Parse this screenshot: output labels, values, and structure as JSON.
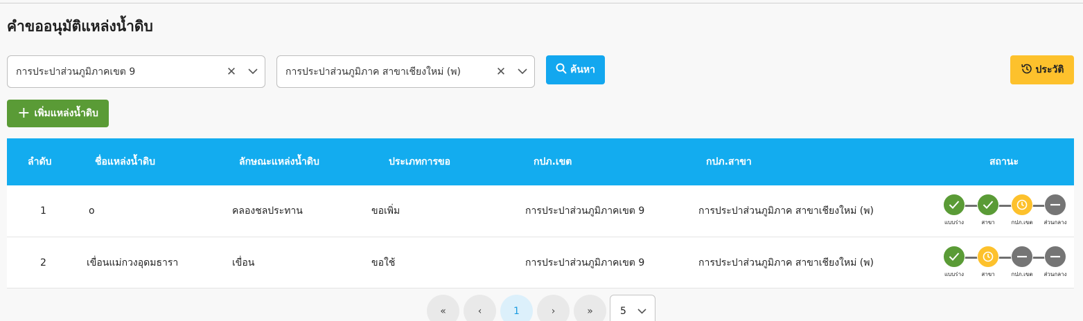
{
  "page": {
    "title": "คำขออนุมัติแหล่งน้ำดิบ"
  },
  "filters": {
    "region_value": "การประปาส่วนภูมิภาคเขต 9",
    "branch_value": "การประปาส่วนภูมิภาค สาขาเชียงใหม่ (พ)",
    "clear_icon": "close-icon",
    "dropdown_icon": "chevron-down-icon"
  },
  "buttons": {
    "search": "ค้นหา",
    "history": "ประวัติ",
    "add": "เพิ่มแหล่งน้ำดิบ"
  },
  "colors": {
    "header_bg": "#13acef",
    "search_bg": "#13a7ef",
    "history_bg": "#fdc12c",
    "add_bg": "#5a9b36",
    "status_done": "#5a9b36",
    "status_pending": "#fdc12c",
    "status_waiting": "#757575"
  },
  "table": {
    "headers": [
      "ลำดับ",
      "ชื่อแหล่งน้ำดิบ",
      "ลักษณะแหล่งน้ำดิบ",
      "ประเภทการขอ",
      "กปภ.เขต",
      "กปภ.สาขา",
      "สถานะ"
    ],
    "rows": [
      {
        "no": "1",
        "name": "o",
        "characteristic": "คลองชลประทาน",
        "request_type": "ขอเพิ่ม",
        "region": "การประปาส่วนภูมิภาคเขต 9",
        "branch": "การประปาส่วนภูมิภาค สาขาเชียงใหม่ (พ)",
        "status": [
          {
            "label": "แบบร่าง",
            "state": "done"
          },
          {
            "label": "สาขา",
            "state": "done"
          },
          {
            "label": "กปภ.เขต",
            "state": "pending"
          },
          {
            "label": "ส่วนกลาง",
            "state": "waiting"
          }
        ]
      },
      {
        "no": "2",
        "name": "เขื่อนแม่กวงอุดมธารา",
        "characteristic": "เขื่อน",
        "request_type": "ขอใช้",
        "region": "การประปาส่วนภูมิภาคเขต 9",
        "branch": "การประปาส่วนภูมิภาค สาขาเชียงใหม่ (พ)",
        "status": [
          {
            "label": "แบบร่าง",
            "state": "done"
          },
          {
            "label": "สาขา",
            "state": "pending"
          },
          {
            "label": "กปภ.เขต",
            "state": "waiting"
          },
          {
            "label": "ส่วนกลาง",
            "state": "waiting"
          }
        ]
      }
    ]
  },
  "pagination": {
    "first": "«",
    "prev": "‹",
    "current": "1",
    "next": "›",
    "last": "»",
    "page_size": "5"
  }
}
